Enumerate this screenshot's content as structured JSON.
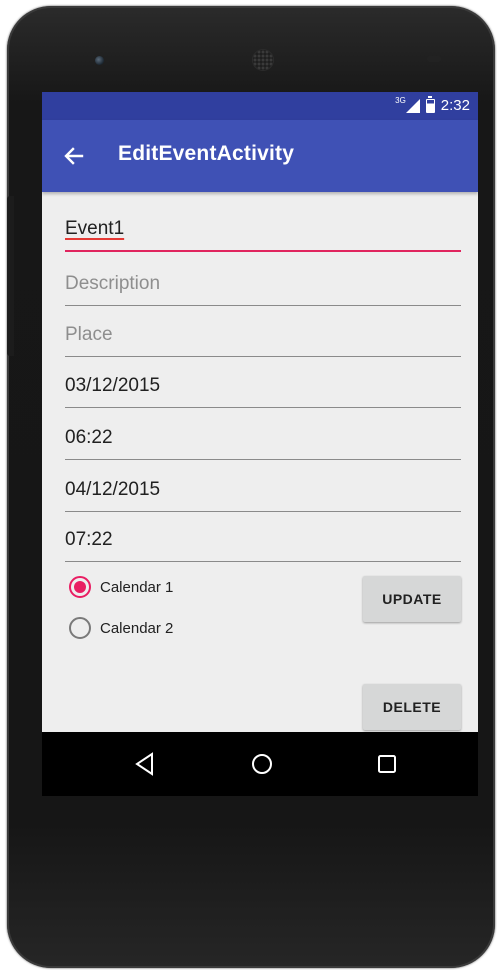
{
  "status_bar": {
    "network": "3G",
    "time": "2:32"
  },
  "app_bar": {
    "title": "EditEventActivity",
    "back_icon": "arrow-back-icon"
  },
  "form": {
    "title_value": "Event1",
    "description_placeholder": "Description",
    "place_placeholder": "Place",
    "start_date": "03/12/2015",
    "start_time": "06:22",
    "end_date": "04/12/2015",
    "end_time": "07:22"
  },
  "calendars": [
    {
      "label": "Calendar 1",
      "selected": true
    },
    {
      "label": "Calendar 2",
      "selected": false
    }
  ],
  "buttons": {
    "update": "UPDATE",
    "delete": "DELETE"
  },
  "nav_bar": {
    "back": "triangle-back-icon",
    "home": "circle-home-icon",
    "recents": "square-recents-icon"
  },
  "colors": {
    "status_bar": "#303f9f",
    "app_bar": "#3f51b5",
    "accent": "#e91e63",
    "background": "#eeeeee"
  }
}
